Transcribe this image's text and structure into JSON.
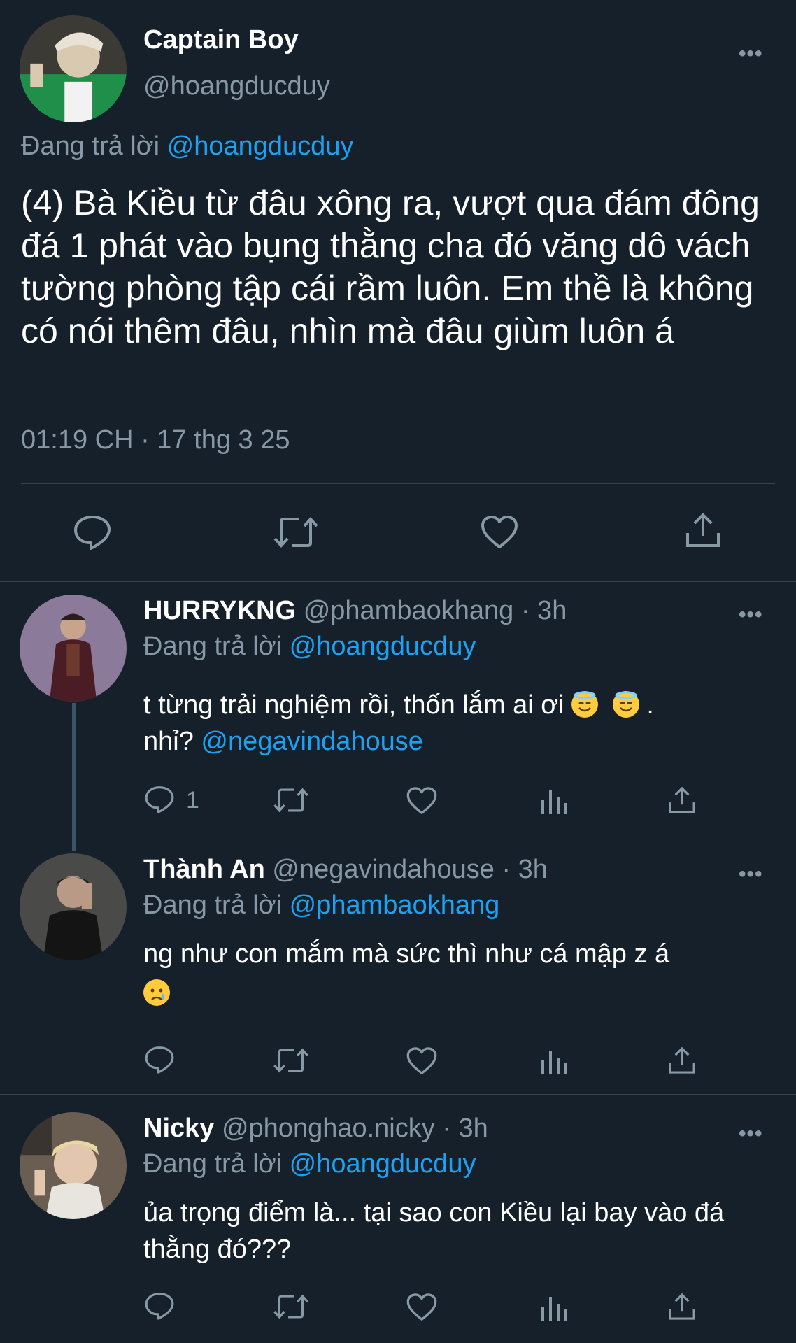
{
  "main_tweet": {
    "display_name": "Captain Boy",
    "handle": "@hoangducduy",
    "replying_prefix": "Đang trả lời",
    "replying_to": "@hoangducduy",
    "text": "(4) Bà Kiều từ đâu xông ra, vượt qua đám đông đá 1 phát vào bụng thằng cha đó văng dô vách tường phòng tập cái rầm luôn. Em thề là không có nói thêm đâu, nhìn mà đâu giùm luôn á",
    "timestamp": "01:19 CH · 17 thg 3 25",
    "more": "•••"
  },
  "replies": [
    {
      "display_name": "HURRYKNG",
      "handle_time": "@phambaokhang · 3h",
      "replying_prefix": "Đang trả lời",
      "replying_to": "@hoangducduy",
      "text_before": "t từng trải nghiệm rồi, thốn lắm ai ơi",
      "text_after_emoji": ".",
      "text_line2": "nhỉ?",
      "mention": "@negavindahouse",
      "reply_count": "1",
      "more": "•••"
    },
    {
      "display_name": "Thành An",
      "handle_time": "@negavindahouse · 3h",
      "replying_prefix": "Đang trả lời",
      "replying_to": "@phambaokhang",
      "text": "ng như con mắm mà sức thì như cá mập z á",
      "more": "•••"
    },
    {
      "display_name": "Nicky",
      "handle_time": "@phonghao.nicky · 3h",
      "replying_prefix": "Đang trả lời",
      "replying_to": "@hoangducduy",
      "text": "ủa trọng điểm là... tại sao con Kiều lại bay vào đá thằng đó???",
      "more": "•••"
    }
  ],
  "icons": {
    "reply": "reply-icon",
    "retweet": "retweet-icon",
    "like": "heart-icon",
    "share": "share-icon",
    "views": "views-icon"
  },
  "colors": {
    "background": "#15202b",
    "accent": "#1da1f2",
    "secondary_text": "#8899a6",
    "divider": "#38444d"
  }
}
